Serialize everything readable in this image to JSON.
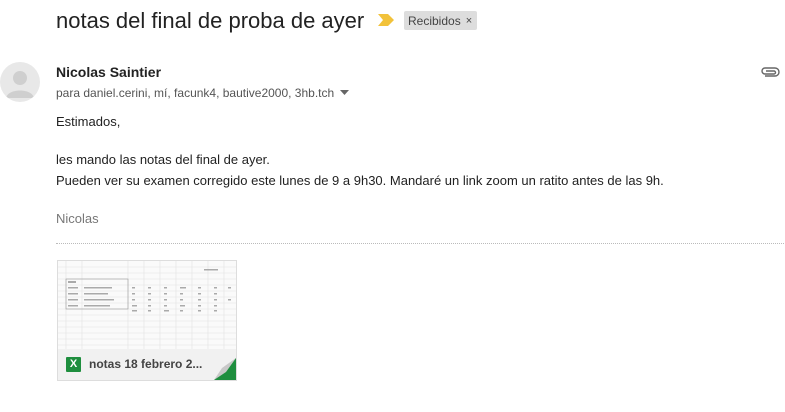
{
  "subject": "notas del final de proba de ayer",
  "label": {
    "name": "Recibidos",
    "remove_glyph": "×"
  },
  "sender": {
    "name": "Nicolas Saintier"
  },
  "recipients": {
    "text": "para daniel.cerini, mí, facunk4, bautive2000, 3hb.tch"
  },
  "body": {
    "greeting": "Estimados,",
    "line1": "les mando las notas del final  de ayer.",
    "line2": "Pueden ver su examen corregido este lunes de 9 a 9h30. Mandaré un link zoom un ratito antes de las 9h.",
    "signature": "Nicolas"
  },
  "attachment": {
    "name": "notas 18 febrero 2...",
    "type_icon": "excel-icon",
    "type_letter": "X"
  },
  "colors": {
    "importance": "#f2c23a",
    "excel": "#1e8e3e",
    "label_bg": "#dddddd"
  }
}
